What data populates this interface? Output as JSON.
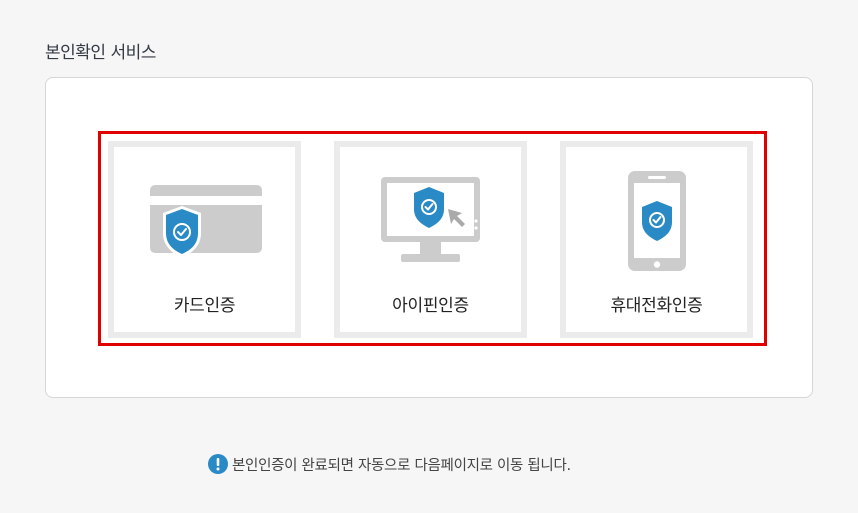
{
  "section": {
    "title": "본인확인 서비스"
  },
  "options": [
    {
      "label": "카드인증",
      "icon": "credit-card-shield-icon"
    },
    {
      "label": "아이핀인증",
      "icon": "monitor-shield-icon"
    },
    {
      "label": "휴대전화인증",
      "icon": "mobile-phone-shield-icon"
    }
  ],
  "notice": {
    "icon": "exclamation-circle-icon",
    "text": "본인인증이 완료되면 자동으로 다음페이지로 이동 됩니다."
  },
  "colors": {
    "accent_blue": "#2a8ac6",
    "highlight_red": "#e00000",
    "icon_gray": "#cccccc",
    "tile_border": "#ebebeb"
  }
}
